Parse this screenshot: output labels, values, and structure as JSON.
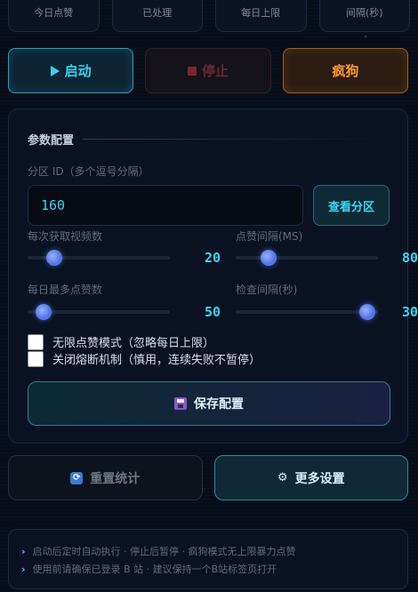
{
  "stats": [
    {
      "label": "今日点赞"
    },
    {
      "label": "已处理"
    },
    {
      "label": "每日上限"
    },
    {
      "label": "间隔(秒)"
    }
  ],
  "actions": {
    "start": "启动",
    "stop": "停止",
    "crazy": "疯狗"
  },
  "config": {
    "title": "参数配置",
    "zone_label": "分区 ID（多个逗号分隔）",
    "zone_value": "160",
    "zone_button": "查看分区",
    "videos_label": "每次获取视频数",
    "videos_value": "20",
    "videos_fraction": 0.15,
    "like_interval_label": "点赞间隔(MS)",
    "like_interval_value": "80",
    "like_interval_fraction": 0.2,
    "daily_max_label": "每日最多点赞数",
    "daily_max_value": "50",
    "daily_max_fraction": 0.06,
    "check_interval_label": "检查间隔(秒)",
    "check_interval_value": "30",
    "check_interval_fraction": 0.98,
    "unlimited_label": "无限点赞模式（忽略每日上限）",
    "unlimited_checked": false,
    "disable_fuse_label": "关闭熔断机制（慎用，连续失败不暂停）",
    "disable_fuse_checked": false,
    "save_button": "保存配置"
  },
  "bottom": {
    "reset_button": "重置统计",
    "more_button": "更多设置"
  },
  "tips": [
    "启动后定时自动执行 · 停止后暂停 · 疯狗模式无上限暴力点赞",
    "使用前请确保已登录 B 站 · 建议保持一个B站标签页打开"
  ],
  "colors": {
    "accent": "#3ad6f2",
    "warning": "#ff9a2e",
    "danger": "#7a2a2e",
    "background": "#070d18"
  }
}
